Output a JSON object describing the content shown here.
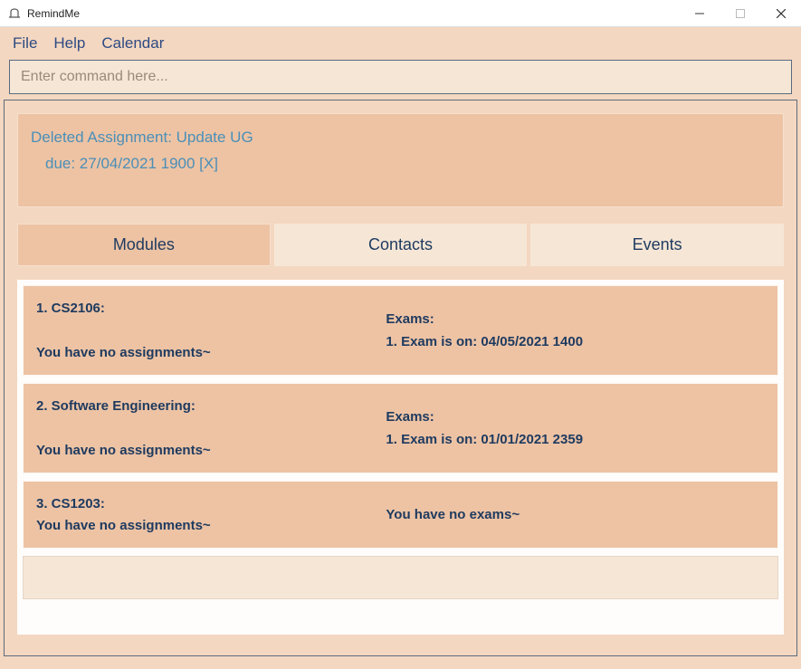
{
  "window": {
    "title": "RemindMe"
  },
  "menu": {
    "file": "File",
    "help": "Help",
    "calendar": "Calendar"
  },
  "command": {
    "placeholder": "Enter command here..."
  },
  "message": {
    "line1": "Deleted Assignment: Update UG",
    "line2": "due: 27/04/2021 1900    [X]"
  },
  "tabs": {
    "modules": "Modules",
    "contacts": "Contacts",
    "events": "Events"
  },
  "modules": [
    {
      "title": "1. CS2106:",
      "assignments": "You have no assignments~",
      "examsHeader": "Exams:",
      "examLine": "1. Exam is on: 04/05/2021 1400"
    },
    {
      "title": "2. Software Engineering:",
      "assignments": "You have no assignments~",
      "examsHeader": "Exams:",
      "examLine": "1. Exam is on: 01/01/2021 2359"
    },
    {
      "title": "3. CS1203:",
      "assignments": "You have no assignments~",
      "examsHeader": "",
      "examLine": "You have no exams~"
    }
  ]
}
